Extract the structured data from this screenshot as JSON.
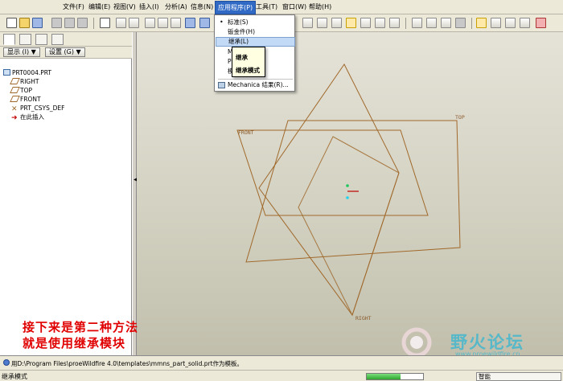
{
  "menubar": {
    "items": [
      {
        "label": "文件(F)"
      },
      {
        "label": "编辑(E)"
      },
      {
        "label": "视图(V)"
      },
      {
        "label": "插入(I)"
      },
      {
        "label": "分析(A)"
      },
      {
        "label": "信息(N)"
      },
      {
        "label": "应用程序(P)",
        "active": true
      },
      {
        "label": "工具(T)"
      },
      {
        "label": "窗口(W)"
      },
      {
        "label": "帮助(H)"
      }
    ]
  },
  "toolbar": {
    "icons": [
      "new-file-icon",
      "open-file-icon",
      "save-icon",
      "print-icon",
      "email-icon",
      "email-attachment-icon",
      "edit-icon",
      "undo-icon",
      "redo-icon",
      "cut-icon",
      "copy-icon",
      "paste-icon",
      "regenerate-icon",
      "zoom-in-icon",
      "zoom-out-icon",
      "zoom-fit-icon",
      "reorient-icon",
      "saved-view-icon",
      "layer-icon",
      "model-display-icon",
      "wireframe-icon",
      "hidden-line-icon",
      "no-hidden-icon",
      "shaded-icon",
      "datum-plane-icon",
      "datum-axis-icon",
      "datum-point-icon",
      "csys-icon",
      "annotation-icon"
    ]
  },
  "left_panel": {
    "show_button": "显示 (I) ▼",
    "settings_button": "设置 (G) ▼",
    "tree": [
      {
        "label": "PRT0004.PRT",
        "icon": "part-icon"
      },
      {
        "label": "RIGHT",
        "icon": "datum-plane-icon"
      },
      {
        "label": "TOP",
        "icon": "datum-plane-icon"
      },
      {
        "label": "FRONT",
        "icon": "datum-plane-icon"
      },
      {
        "label": "PRT_CSYS_DEF",
        "icon": "csys-icon"
      },
      {
        "label": "在此插入",
        "icon": "insert-here-icon"
      }
    ]
  },
  "graphics": {
    "labels": {
      "front": "FRONT",
      "top": "TOP",
      "right": "RIGHT"
    },
    "overlay_lines": [
      "接下来是第二种方法",
      "就是使用继承模块"
    ],
    "plane_color": "#a0692b"
  },
  "app_menu": {
    "items": [
      {
        "label": "标准(S)",
        "bullet": true
      },
      {
        "label": "钣金件(H)"
      },
      {
        "label": "继承(L)",
        "highlight": true
      },
      {
        "label": "Me"
      },
      {
        "label": "Pl"
      },
      {
        "label": "模"
      },
      {
        "label": "Mechanica 结果(R)...",
        "icon": "mechanica-icon"
      }
    ],
    "submenu": [
      "继承",
      "继承模式"
    ]
  },
  "watermark": {
    "title": "野火论坛",
    "url": "www.proewildfire.cn",
    "accent": "#56b8c8"
  },
  "message_bar": {
    "text": "用D:\\Program Files\\proeWildfire 4.0\\templates\\mmns_part_solid.prt作为模板。"
  },
  "status_bar": {
    "left_text": "继承模式",
    "filter_field": "智能",
    "progress": 0.6
  }
}
